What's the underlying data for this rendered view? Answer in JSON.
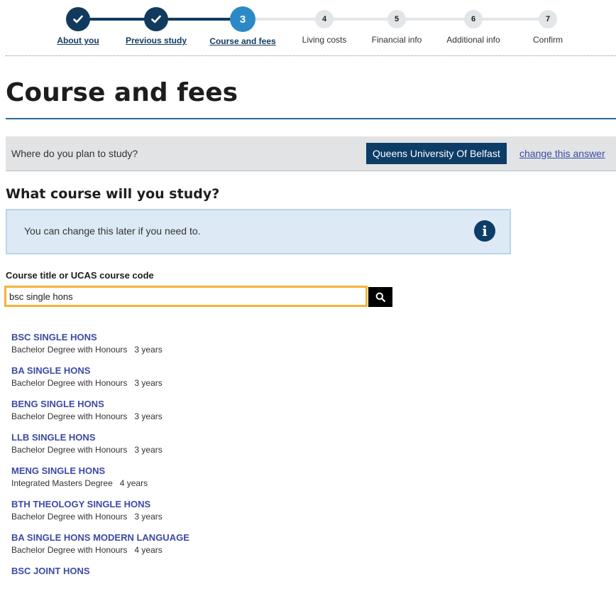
{
  "stepper": {
    "steps": [
      {
        "number": "✓",
        "label": "About you",
        "state": "done"
      },
      {
        "number": "✓",
        "label": "Previous study",
        "state": "done"
      },
      {
        "number": "3",
        "label": "Course and fees",
        "state": "current"
      },
      {
        "number": "4",
        "label": "Living costs",
        "state": "todo"
      },
      {
        "number": "5",
        "label": "Financial info",
        "state": "todo"
      },
      {
        "number": "6",
        "label": "Additional info",
        "state": "todo"
      },
      {
        "number": "7",
        "label": "Confirm",
        "state": "todo"
      }
    ]
  },
  "page": {
    "title": "Course and fees"
  },
  "answer": {
    "question": "Where do you plan to study?",
    "value": "Queens University Of Belfast",
    "change_link": "change this answer"
  },
  "course": {
    "heading": "What course will you study?",
    "info": "You can change this later if you need to.",
    "field_label": "Course title or UCAS course code",
    "search_value": "bsc single hons",
    "search_icon": "search-icon"
  },
  "results": [
    {
      "title": "BSC SINGLE HONS",
      "degree": "Bachelor Degree with Honours",
      "duration": "3 years"
    },
    {
      "title": "BA SINGLE HONS",
      "degree": "Bachelor Degree with Honours",
      "duration": "3 years"
    },
    {
      "title": "BENG SINGLE HONS",
      "degree": "Bachelor Degree with Honours",
      "duration": "3 years"
    },
    {
      "title": "LLB SINGLE HONS",
      "degree": "Bachelor Degree with Honours",
      "duration": "3 years"
    },
    {
      "title": "MENG SINGLE HONS",
      "degree": "Integrated Masters Degree",
      "duration": "4 years"
    },
    {
      "title": "BTH THEOLOGY SINGLE HONS",
      "degree": "Bachelor Degree with Honours",
      "duration": "3 years"
    },
    {
      "title": "BA SINGLE HONS MODERN LANGUAGE",
      "degree": "Bachelor Degree with Honours",
      "duration": "4 years"
    },
    {
      "title": "BSC JOINT HONS",
      "degree": "",
      "duration": ""
    }
  ],
  "colors": {
    "primary": "#123a5f",
    "current_step": "#2b8ac6",
    "link": "#3c4aa5",
    "focus": "#f5b23c",
    "info_bg": "#ddeaf6"
  }
}
